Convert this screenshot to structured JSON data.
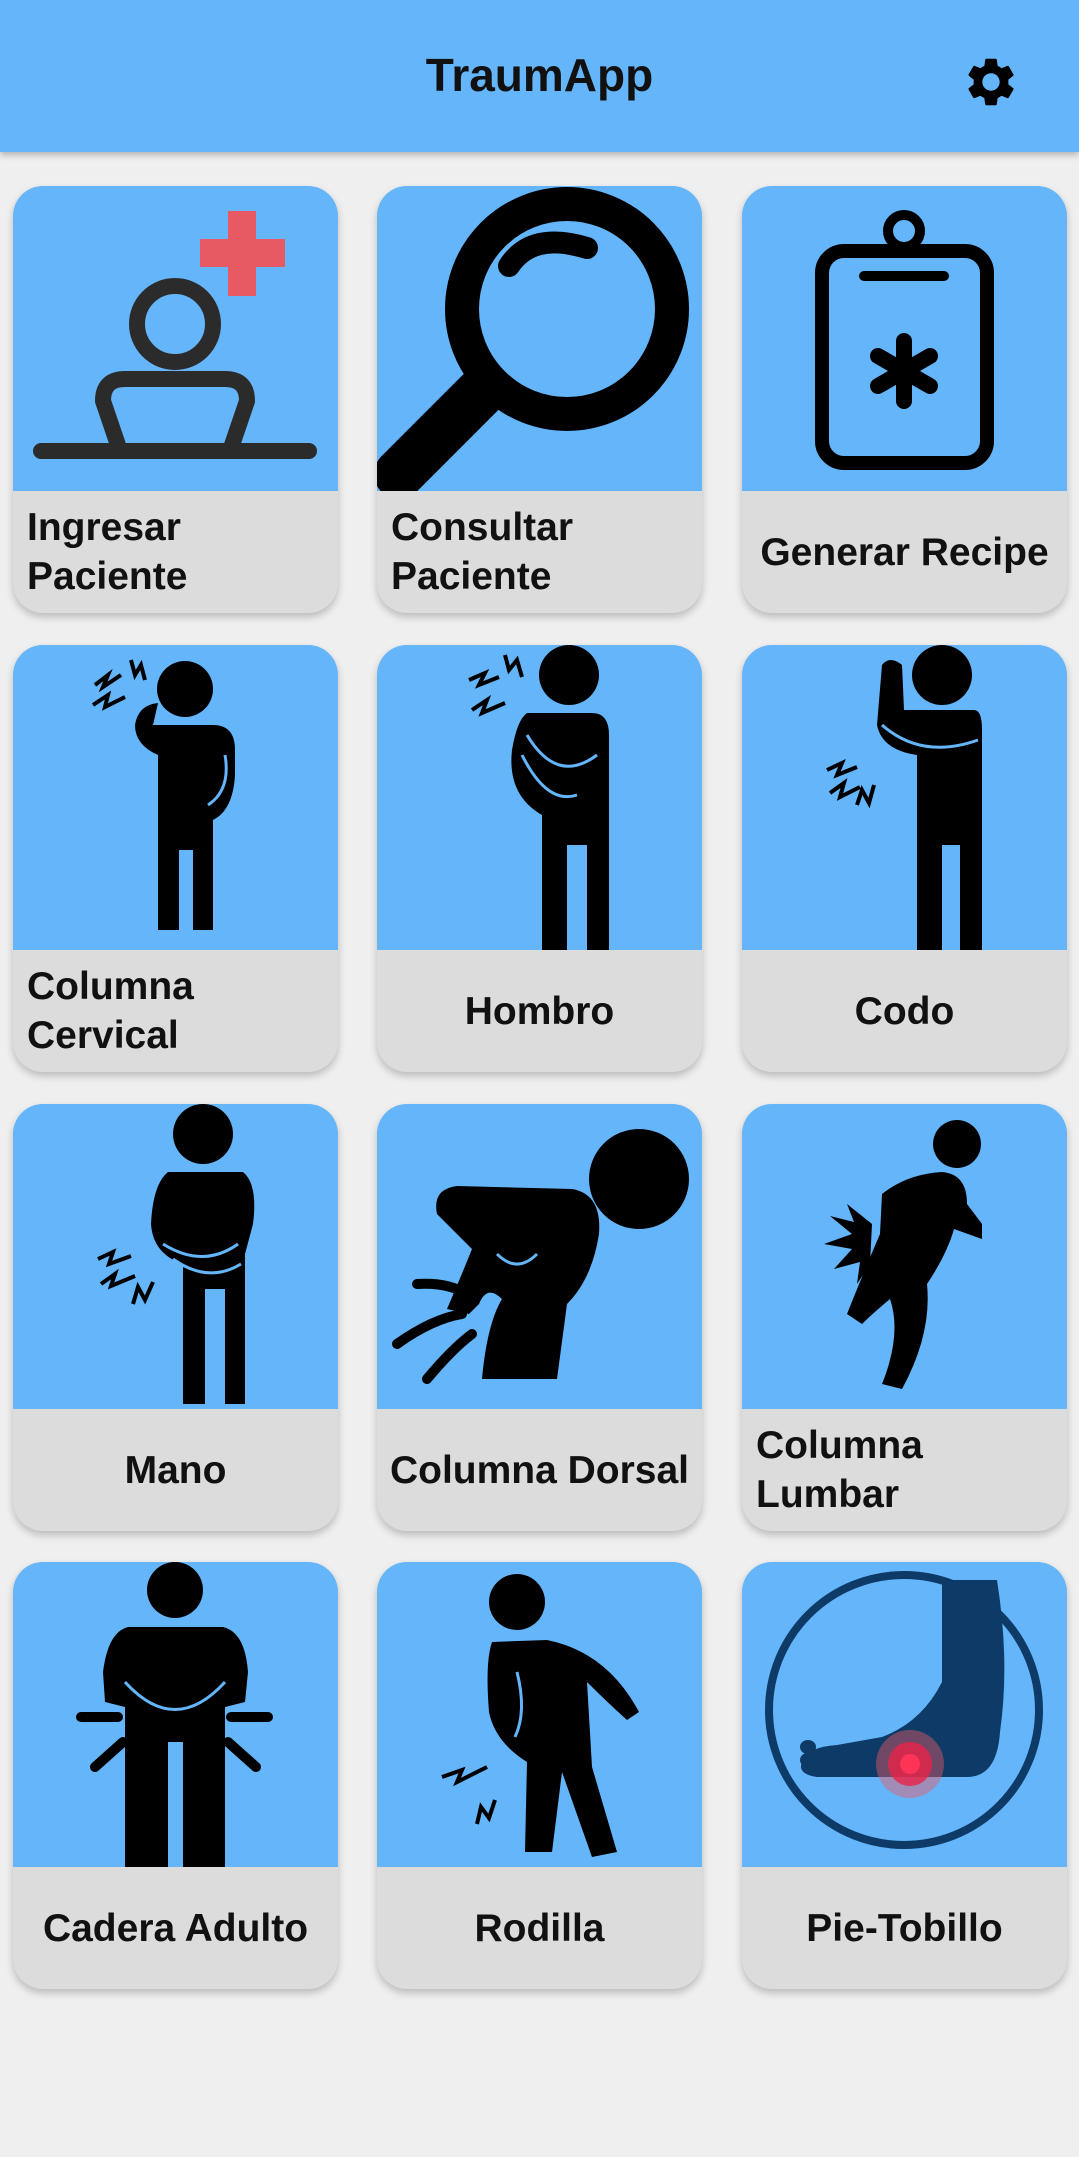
{
  "app": {
    "title": "TraumApp",
    "settings_icon": "gear-icon"
  },
  "colors": {
    "appbar": "#64b5fa",
    "tile": "#64b5fa",
    "label_bg": "#dcdcdc",
    "background": "#efefef",
    "accent_red": "#e85a63",
    "dark_blue": "#0d3a66"
  },
  "cards": [
    {
      "label": "Ingresar\nPaciente",
      "icon": "add-patient-icon"
    },
    {
      "label": "Consultar\nPaciente",
      "icon": "magnifier-icon"
    },
    {
      "label": "Generar Recipe",
      "icon": "clipboard-icon"
    },
    {
      "label": "Columna\nCervical",
      "icon": "neck-pain-icon"
    },
    {
      "label": "Hombro",
      "icon": "shoulder-pain-icon"
    },
    {
      "label": "Codo",
      "icon": "elbow-pain-icon"
    },
    {
      "label": "Mano",
      "icon": "hand-pain-icon"
    },
    {
      "label": "Columna Dorsal",
      "icon": "back-pain-icon"
    },
    {
      "label": "Columna\nLumbar",
      "icon": "lumbar-pain-icon"
    },
    {
      "label": "Cadera Adulto",
      "icon": "hip-pain-icon"
    },
    {
      "label": "Rodilla",
      "icon": "knee-pain-icon"
    },
    {
      "label": "Pie-Tobillo",
      "icon": "foot-pain-icon"
    }
  ]
}
